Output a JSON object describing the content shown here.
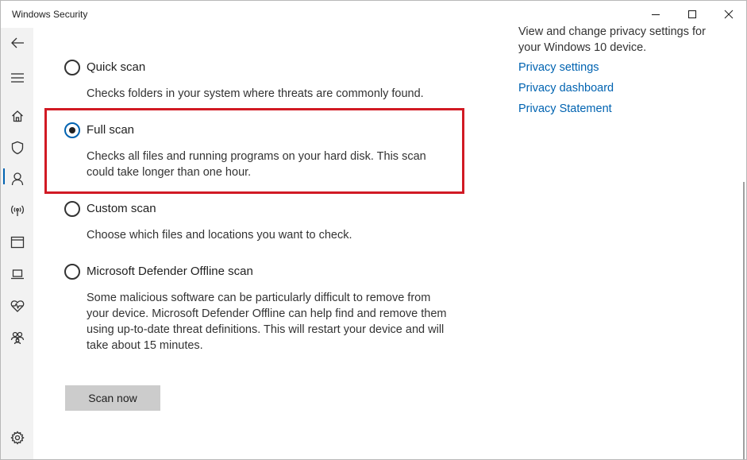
{
  "window": {
    "title": "Windows Security"
  },
  "sidebar": {
    "items": [
      {
        "name": "back-icon"
      },
      {
        "name": "menu-icon"
      },
      {
        "name": "home-icon"
      },
      {
        "name": "shield-icon"
      },
      {
        "name": "person-icon"
      },
      {
        "name": "wifi-icon"
      },
      {
        "name": "browser-icon"
      },
      {
        "name": "laptop-icon"
      },
      {
        "name": "health-icon"
      },
      {
        "name": "family-icon"
      },
      {
        "name": "gear-icon"
      }
    ],
    "active_item": "shield-icon"
  },
  "scan_options": [
    {
      "label": "Quick scan",
      "description": "Checks folders in your system where threats are commonly found.",
      "selected": false
    },
    {
      "label": "Full scan",
      "description": "Checks all files and running programs on your hard disk. This scan could take longer than one hour.",
      "selected": true
    },
    {
      "label": "Custom scan",
      "description": "Choose which files and locations you want to check.",
      "selected": false
    },
    {
      "label": "Microsoft Defender Offline scan",
      "description": "Some malicious software can be particularly difficult to remove from your device. Microsoft Defender Offline can help find and remove them using up-to-date threat definitions. This will restart your device and will take about 15 minutes.",
      "selected": false
    }
  ],
  "scan_button": {
    "label": "Scan now"
  },
  "privacy": {
    "text": "View and change privacy settings for your Windows 10 device.",
    "links": [
      "Privacy settings",
      "Privacy dashboard",
      "Privacy Statement"
    ]
  },
  "colors": {
    "accent": "#0063b1",
    "highlight_border": "#d11a24",
    "sidebar_bg": "#f2f2f2",
    "button_bg": "#cccccc"
  }
}
